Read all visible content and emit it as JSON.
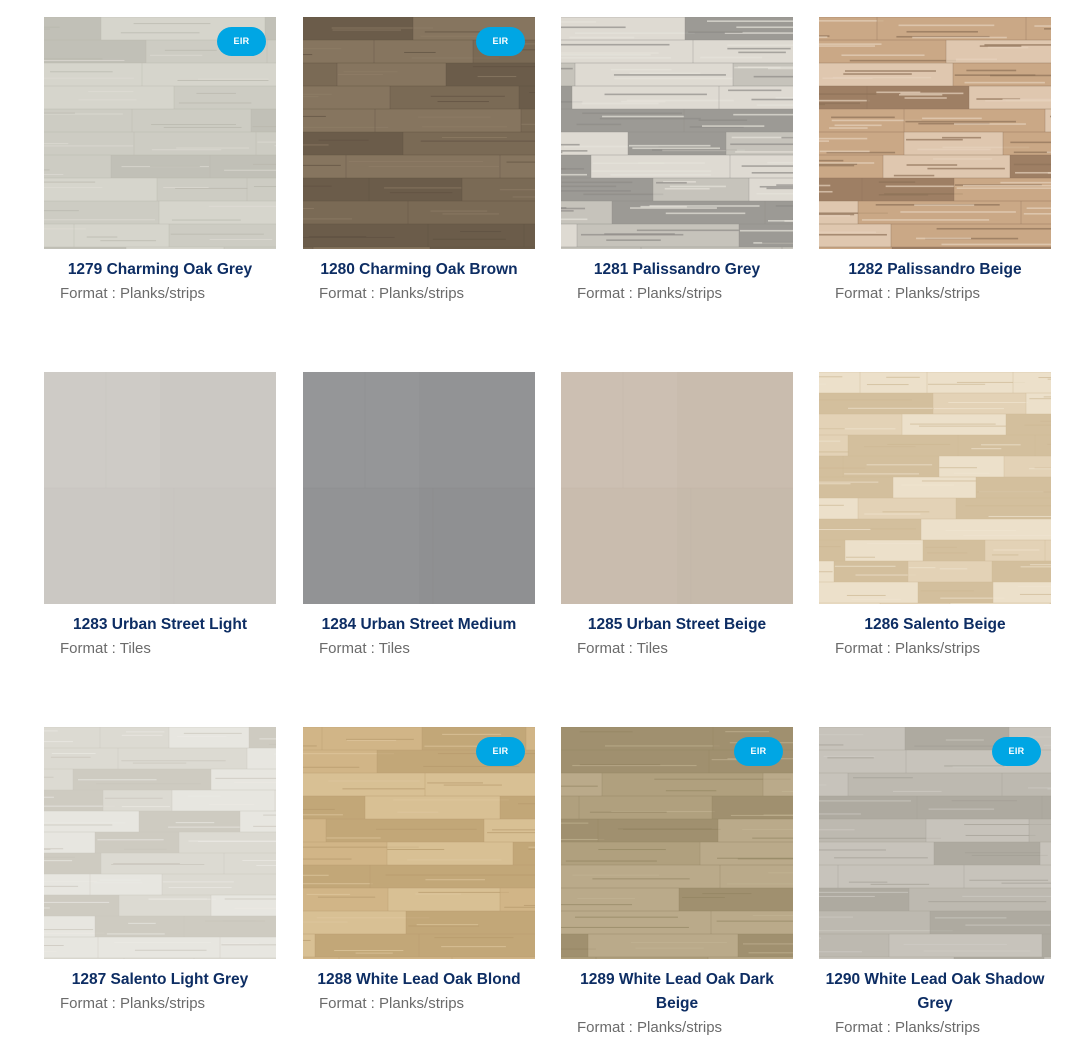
{
  "badge_label": "EIR",
  "format_prefix": "Format : ",
  "products": [
    {
      "name": "1279 Charming Oak Grey",
      "format": "Planks/strips",
      "badge": true,
      "texture": "planks",
      "base": "#cdccc3",
      "shade": "#b8b7ad",
      "light": "#dedcd4"
    },
    {
      "name": "1280 Charming Oak Brown",
      "format": "Planks/strips",
      "badge": true,
      "texture": "planks",
      "base": "#7a6a55",
      "shade": "#5f5141",
      "light": "#8f7e67"
    },
    {
      "name": "1281 Palissandro Grey",
      "format": "Planks/strips",
      "badge": false,
      "texture": "palissandro",
      "base": "#c6c3bb",
      "shade": "#8e8c88",
      "light": "#e6e2da"
    },
    {
      "name": "1282 Palissandro Beige",
      "format": "Planks/strips",
      "badge": false,
      "texture": "palissandro",
      "base": "#c9a886",
      "shade": "#8f7258",
      "light": "#e6d2bc"
    },
    {
      "name": "1283 Urban Street Light",
      "format": "Tiles",
      "badge": false,
      "texture": "tiles",
      "base": "#cbc8c3",
      "shade": "#c2bfba",
      "light": "#d3d0cb"
    },
    {
      "name": "1284 Urban Street Medium",
      "format": "Tiles",
      "badge": false,
      "texture": "tiles",
      "base": "#929395",
      "shade": "#87888a",
      "light": "#9c9d9f"
    },
    {
      "name": "1285 Urban Street Beige",
      "format": "Tiles",
      "badge": false,
      "texture": "tiles",
      "base": "#c9bcae",
      "shade": "#bfb2a4",
      "light": "#d2c6b9"
    },
    {
      "name": "1286 Salento Beige",
      "format": "Planks/strips",
      "badge": false,
      "texture": "salento",
      "base": "#e3d2b6",
      "shade": "#cdb894",
      "light": "#efe4d0"
    },
    {
      "name": "1287 Salento Light Grey",
      "format": "Planks/strips",
      "badge": false,
      "texture": "salento",
      "base": "#dcd9d2",
      "shade": "#c9c5bb",
      "light": "#ebe9e4"
    },
    {
      "name": "1288 White Lead Oak Blond",
      "format": "Planks/strips",
      "badge": true,
      "texture": "planks",
      "base": "#d1b587",
      "shade": "#b69a6c",
      "light": "#dfc89f"
    },
    {
      "name": "1289 White Lead Oak Dark Beige",
      "format": "Planks/strips",
      "badge": true,
      "texture": "planks",
      "base": "#b0a07e",
      "shade": "#938463",
      "light": "#c2b393"
    },
    {
      "name": "1290 White Lead Oak Shadow Grey",
      "format": "Planks/strips",
      "badge": true,
      "texture": "planks",
      "base": "#bdb9b0",
      "shade": "#a29e94",
      "light": "#cfccc4"
    }
  ],
  "colors": {
    "title": "#0d2d63",
    "meta": "#6b6b6b",
    "badge_bg": "#00a6e4",
    "badge_text": "#ffffff"
  }
}
